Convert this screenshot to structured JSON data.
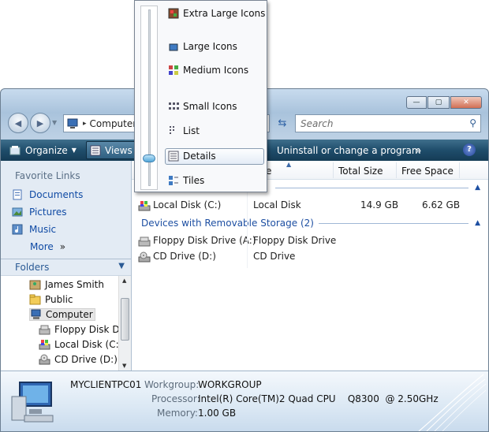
{
  "window": {
    "controls": {
      "minimize": "—",
      "maximize": "▢",
      "close": "✕"
    }
  },
  "address": {
    "current": "Computer",
    "separator": "▸",
    "search_placeholder": "Search"
  },
  "command_bar": {
    "organize": "Organize",
    "views": "Views",
    "uninstall": "Uninstall or change a program",
    "more": "»",
    "help": "?"
  },
  "view_menu": {
    "items": [
      {
        "label": "Extra Large Icons",
        "icon": "extra-large-icons-icon"
      },
      {
        "label": "Large Icons",
        "icon": "large-icons-icon"
      },
      {
        "label": "Medium Icons",
        "icon": "medium-icons-icon"
      },
      {
        "label": "Small Icons",
        "icon": "small-icons-icon"
      },
      {
        "label": "List",
        "icon": "list-icon"
      },
      {
        "label": "Details",
        "icon": "details-icon"
      },
      {
        "label": "Tiles",
        "icon": "tiles-icon"
      }
    ],
    "selected": "Details"
  },
  "nav": {
    "favorite_links_title": "Favorite Links",
    "favorites": [
      {
        "label": "Documents",
        "icon": "documents-icon"
      },
      {
        "label": "Pictures",
        "icon": "pictures-icon"
      },
      {
        "label": "Music",
        "icon": "music-icon"
      }
    ],
    "more_label": "More",
    "more_glyph": "»",
    "folders_title": "Folders",
    "tree": [
      {
        "label": "James Smith",
        "icon": "user-folder-icon"
      },
      {
        "label": "Public",
        "icon": "folder-icon"
      },
      {
        "label": "Computer",
        "icon": "computer-icon"
      },
      {
        "label": "Floppy Disk Dr",
        "icon": "floppy-drive-icon"
      },
      {
        "label": "Local Disk (C:)",
        "icon": "hard-disk-icon"
      },
      {
        "label": "CD Drive (D:)",
        "icon": "cd-drive-icon"
      }
    ]
  },
  "content": {
    "columns": [
      "e",
      "Total Size",
      "Free Space"
    ],
    "groups": {
      "devices_removable": "Devices with Removable Storage (2)"
    },
    "rows": [
      {
        "name": "Local Disk (C:)",
        "type": "Local Disk",
        "total": "14.9 GB",
        "free": "6.62 GB",
        "icon": "hard-disk-icon"
      },
      {
        "name": "Floppy Disk Drive (A:)",
        "type": "Floppy Disk Drive",
        "total": "",
        "free": "",
        "icon": "floppy-drive-icon"
      },
      {
        "name": "CD Drive (D:)",
        "type": "CD Drive",
        "total": "",
        "free": "",
        "icon": "cd-drive-icon"
      }
    ]
  },
  "details_pane": {
    "computer_name": "MYCLIENTPC01",
    "workgroup_label": "Workgroup:",
    "workgroup_value": "WORKGROUP",
    "processor_label": "Processor:",
    "processor_value": "Intel(R) Core(TM)2 Quad CPU    Q8300  @ 2.50GHz",
    "memory_label": "Memory:",
    "memory_value": "1.00 GB"
  },
  "colors": {
    "command_bar": "#1f4d6b",
    "link_blue": "#0f4aa4",
    "group_blue": "#1d4fa2"
  }
}
